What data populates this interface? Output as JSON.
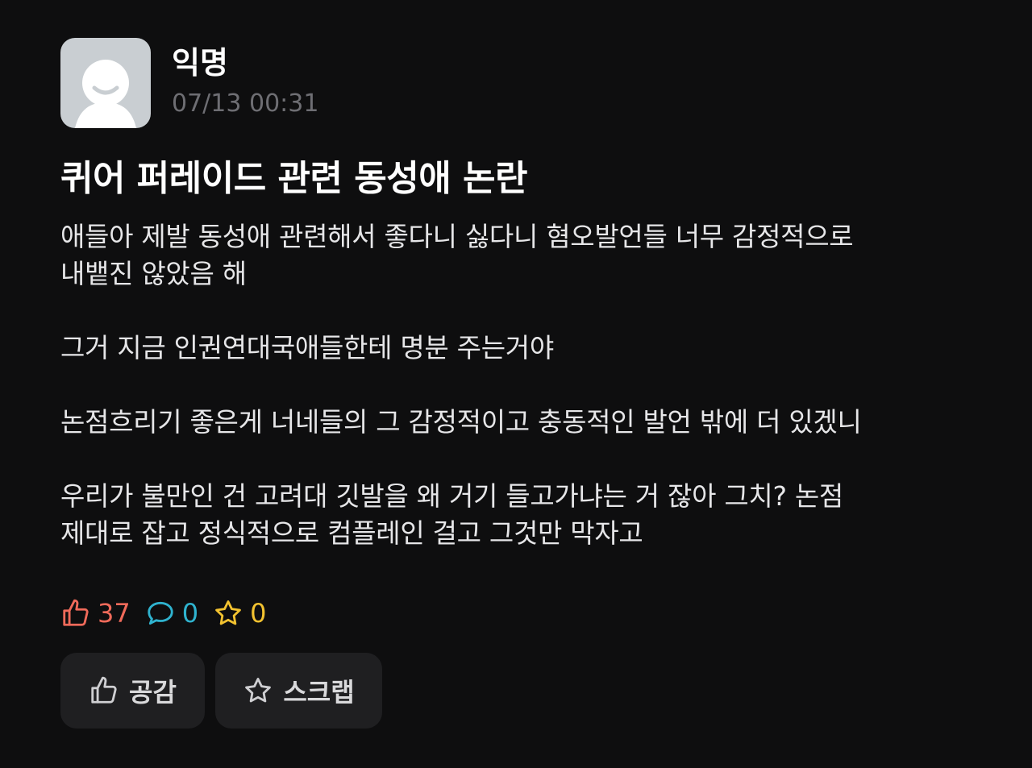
{
  "post": {
    "author": "익명",
    "timestamp": "07/13 00:31",
    "title": "퀴어 퍼레이드 관련 동성애 논란",
    "paragraphs": [
      "애들아 제발 동성애 관련해서 좋다니 싫다니 혐오발언들 너무 감정적으로\n내뱉진 않았음 해",
      "그거 지금 인권연대국애들한테 명분 주는거야",
      "논점흐리기 좋은게 너네들의 그 감정적이고 충동적인 발언 밖에 더 있겠니",
      "우리가 불만인 건 고려대 깃발을 왜 거기 들고가냐는 거 잖아 그치? 논점\n제대로 잡고 정식적으로 컴플레인 걸고 그것만 막자고"
    ]
  },
  "stats": {
    "likes": "37",
    "comments": "0",
    "scraps": "0"
  },
  "actions": {
    "like_label": "공감",
    "scrap_label": "스크랩"
  },
  "colors": {
    "background": "#0e0e0f",
    "like": "#f06a5a",
    "comment": "#2fb3cf",
    "scrap": "#f2c230",
    "timestamp": "#6e6e73",
    "button_bg": "#1f1f21"
  },
  "icons": {
    "avatar": "default-profile-icon",
    "like": "thumbs-up-icon",
    "comment": "speech-bubble-icon",
    "scrap": "star-icon"
  }
}
